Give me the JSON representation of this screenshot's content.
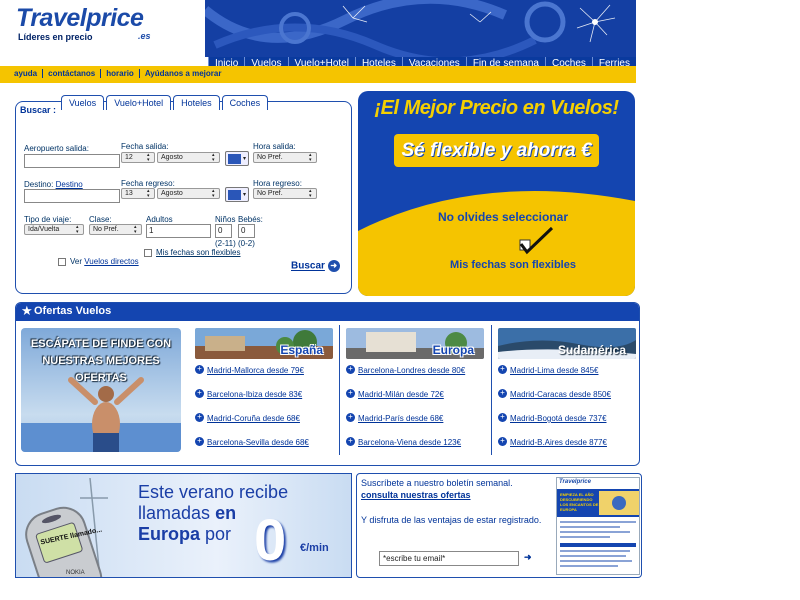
{
  "header": {
    "logo": "Travelprice",
    "logo_suffix": ".es",
    "tagline": "Líderes en precio",
    "nav_tabs": [
      "Inicio",
      "Vuelos",
      "Vuelo+Hotel",
      "Hoteles",
      "Vacaciones",
      "Fin de semana",
      "Coches",
      "Ferries"
    ],
    "top_links": [
      "ayuda",
      "contáctanos",
      "horario",
      "Ayúdanos a mejorar"
    ]
  },
  "search": {
    "title": "Buscar :",
    "tabs": [
      "Vuelos",
      "Vuelo+Hotel",
      "Hoteles",
      "Coches"
    ],
    "origin_label": "Aeropuerto salida:",
    "origin_value": "",
    "dep_date_label": "Fecha salida:",
    "dep_day": "12",
    "dep_month": "Agosto",
    "dep_time_label": "Hora salida:",
    "dep_time": "No Pref.",
    "dest_label": "Destino:",
    "dest_link": "Destino",
    "dest_value": "",
    "ret_date_label": "Fecha regreso:",
    "ret_day": "13",
    "ret_month": "Agosto",
    "ret_time_label": "Hora regreso:",
    "ret_time": "No Pref.",
    "trip_type_label": "Tipo de viaje:",
    "trip_type": "Ida/Vuelta",
    "class_label": "Clase:",
    "class_value": "No Pref.",
    "adults_label": "Adultos",
    "adults_value": "1",
    "children_label": "Niños",
    "children_value": "0",
    "children_note": "(2-11)",
    "babies_label": "Bebés:",
    "babies_value": "0",
    "babies_note": "(0-2)",
    "flexible_label": "Mis fechas son flexibles",
    "direct_prefix": "Ver",
    "direct_link": "Vuelos directos",
    "submit": "Buscar"
  },
  "promo": {
    "title": "¡El Mejor Precio en Vuelos!",
    "subtitle": "Sé flexible y ahorra €",
    "reminder": "No olvides seleccionar",
    "flexible": "Mis fechas son flexibles"
  },
  "ofertas": {
    "title": "Ofertas Vuelos",
    "promo_text": "ESCÁPATE DE FINDE CON NUESTRAS MEJORES OFERTAS",
    "columns": [
      {
        "title": "España",
        "offers": [
          "Madrid-Mallorca desde 79€",
          "Barcelona-Ibiza desde 83€",
          "Madrid-Coruña desde 68€",
          "Barcelona-Sevilla desde 68€"
        ]
      },
      {
        "title": "Europa",
        "offers": [
          "Barcelona-Londres desde 80€",
          "Madrid-Milán desde 72€",
          "Madrid-París desde 68€",
          "Barcelona-Viena desde 123€"
        ]
      },
      {
        "title": "Sudamérica",
        "offers": [
          "Madrid-Lima desde 845€",
          "Madrid-Caracas desde 850€",
          "Madrid-Bogotá desde 737€",
          "Madrid-B.Aires desde 877€"
        ]
      }
    ]
  },
  "phone_banner": {
    "line1": "Este verano recibe",
    "line2": "llamadas",
    "line2b": "en",
    "line3": "Europa",
    "line3b": "por",
    "price": "0",
    "unit": "€/min",
    "screen_text": "SUERTE llamado...",
    "brand": "NOKIA"
  },
  "newsletter": {
    "line1": "Suscríbete a nuestro boletín semanal.",
    "link": "consulta nuestras ofertas",
    "line2": "Y disfruta de las ventajas de estar registrado.",
    "email_value": "*escribe tu email*",
    "thumb_brand": "Travelprice",
    "thumb_headline": "EMPIEZA EL AÑO DESCUBRIENDO LOS ENCANTOS DE EUROPA"
  },
  "colors": {
    "brand_blue": "#1445b0",
    "brand_yellow": "#f5c400"
  }
}
